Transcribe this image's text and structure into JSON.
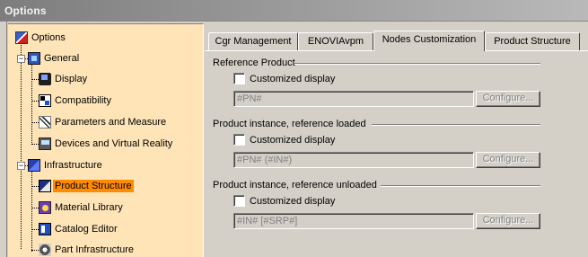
{
  "window": {
    "title": "Options"
  },
  "tree": {
    "root": "Options",
    "items": [
      {
        "label": "General",
        "level": 1,
        "expanded": true,
        "icon": "general-icon"
      },
      {
        "label": "Display",
        "level": 2,
        "icon": "display-icon"
      },
      {
        "label": "Compatibility",
        "level": 2,
        "icon": "compatibility-icon"
      },
      {
        "label": "Parameters and Measure",
        "level": 2,
        "icon": "parameters-icon"
      },
      {
        "label": "Devices and Virtual Reality",
        "level": 2,
        "icon": "devices-icon"
      },
      {
        "label": "Infrastructure",
        "level": 1,
        "expanded": true,
        "icon": "infrastructure-icon"
      },
      {
        "label": "Product Structure",
        "level": 2,
        "selected": true,
        "icon": "product-structure-icon"
      },
      {
        "label": "Material Library",
        "level": 2,
        "icon": "material-library-icon"
      },
      {
        "label": "Catalog Editor",
        "level": 2,
        "icon": "catalog-editor-icon"
      },
      {
        "label": "Part Infrastructure",
        "level": 2,
        "icon": "part-infrastructure-icon"
      }
    ],
    "selected_color": "#ff8c00",
    "background_color": "#ffe4b8"
  },
  "tabs": [
    {
      "label": "Cgr Management"
    },
    {
      "label": "ENOVIAvpm"
    },
    {
      "label": "Nodes Customization",
      "active": true
    },
    {
      "label": "Product Structure"
    }
  ],
  "groups": [
    {
      "title": "Reference Product",
      "checkbox_label": "Customized display",
      "checked": false,
      "field_value": "#PN#",
      "button_label": "Configure..."
    },
    {
      "title": "Product instance, reference loaded",
      "checkbox_label": "Customized display",
      "checked": false,
      "field_value": "#PN# (#IN#)",
      "button_label": "Configure..."
    },
    {
      "title": "Product instance, reference unloaded",
      "checkbox_label": "Customized display",
      "checked": false,
      "field_value": "#IN# [#SRP#]",
      "button_label": "Configure..."
    }
  ]
}
